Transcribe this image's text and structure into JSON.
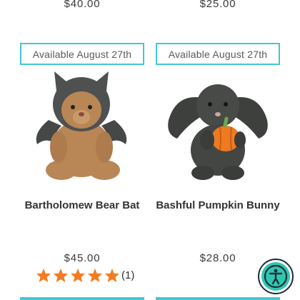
{
  "previous_row": {
    "left_price": "$40.00",
    "right_price": "$25.00"
  },
  "products": [
    {
      "badge": "Available August 27th",
      "title": "Bartholomew Bear Bat",
      "price": "$45.00",
      "rating": 5,
      "review_count": "(1)",
      "image_icon": "teddy-bear-bat-costume"
    },
    {
      "badge": "Available August 27th",
      "title": "Bashful Pumpkin Bunny",
      "price": "$28.00",
      "image_icon": "dark-bunny-with-pumpkin"
    }
  ],
  "colors": {
    "badge_border": "#44c6d3",
    "star": "#f47c20",
    "accessibility_button": "#2fc7b2"
  },
  "accessibility_button_icon": "accessibility-icon"
}
